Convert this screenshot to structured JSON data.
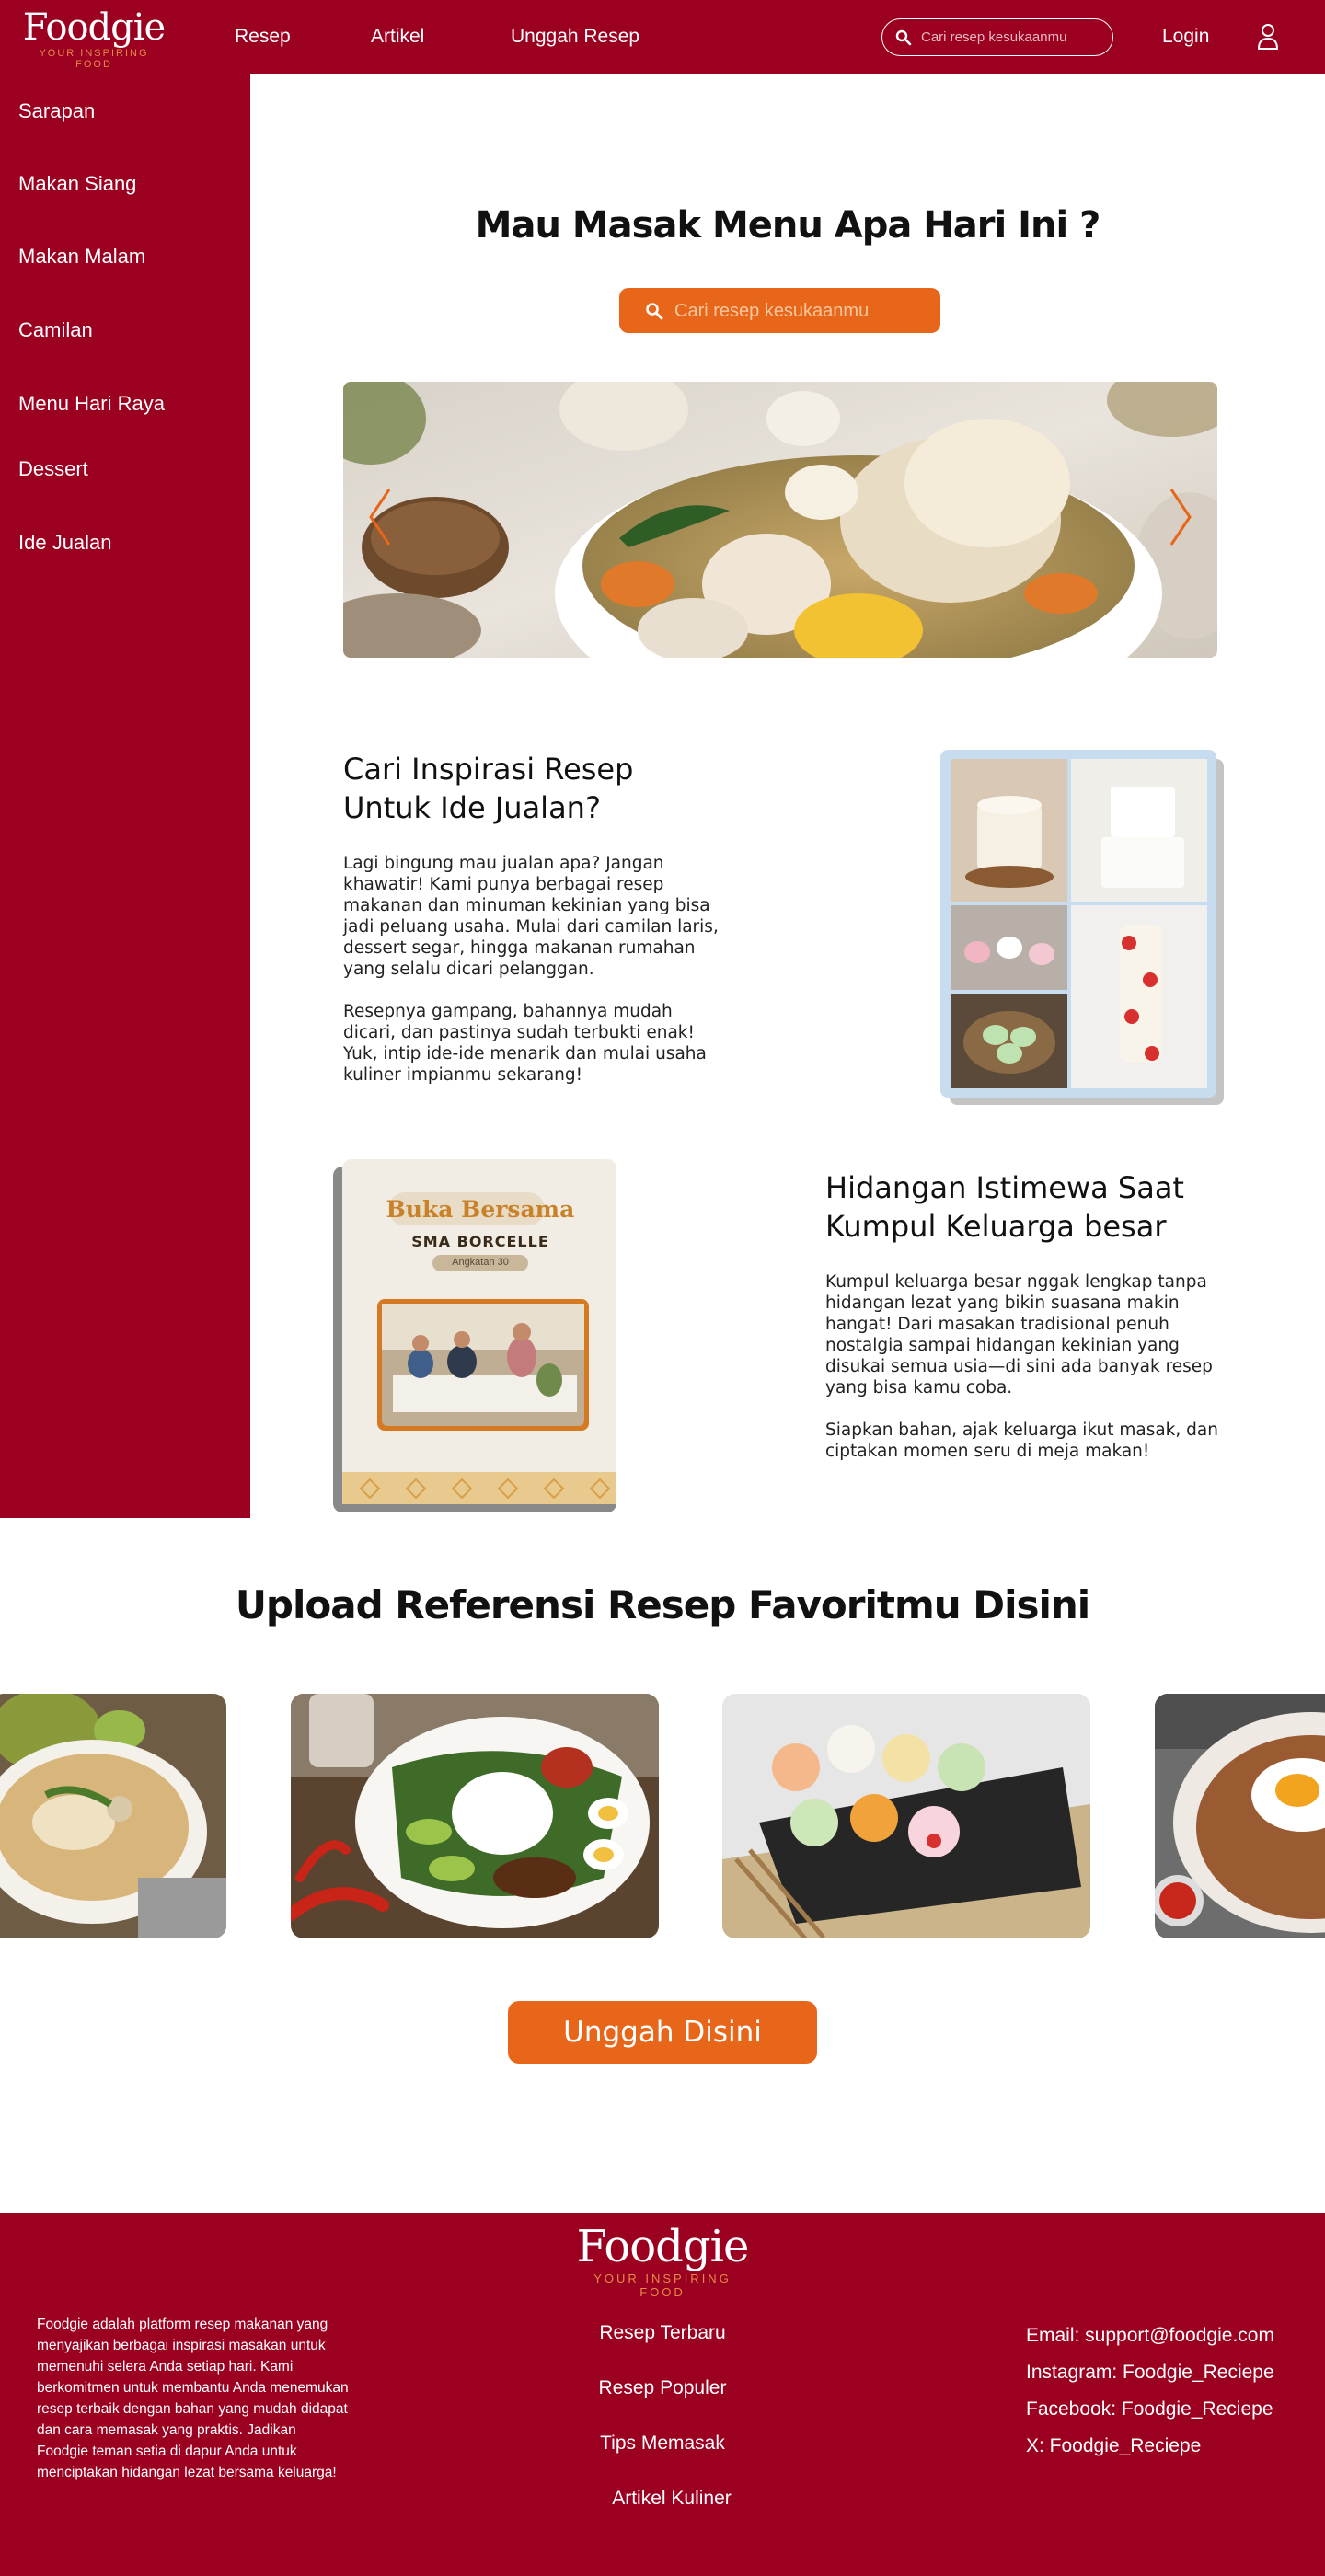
{
  "brand": {
    "name": "Foodgie",
    "tagline": "YOUR INSPIRING FOOD",
    "color_primary": "#9c0020",
    "color_accent": "#e8661a"
  },
  "header": {
    "nav": [
      "Resep",
      "Artikel",
      "Unggah Resep"
    ],
    "search_placeholder": "Cari resep kesukaanmu",
    "login_label": "Login",
    "icons": [
      "search-icon",
      "user-icon"
    ]
  },
  "sidebar": {
    "items": [
      "Sarapan",
      "Makan Siang",
      "Makan Malam",
      "Camilan",
      "Menu Hari Raya",
      "Dessert",
      "Ide Jualan"
    ]
  },
  "hero": {
    "title": "Mau Masak Menu Apa Hari Ini ?",
    "search_placeholder": "Cari resep kesukaanmu",
    "carousel_icons": [
      "chevron-left-icon",
      "chevron-right-icon"
    ]
  },
  "section_jualan": {
    "title": "Cari Inspirasi Resep Untuk Ide Jualan?",
    "paragraph1": "Lagi bingung mau jualan apa? Jangan khawatir! Kami punya berbagai resep makanan dan minuman kekinian yang bisa jadi peluang usaha. Mulai dari camilan laris, dessert segar, hingga makanan rumahan yang selalu dicari pelanggan.",
    "paragraph2": "Resepnya gampang, bahannya mudah dicari, dan pastinya sudah terbukti enak! Yuk, intip ide-ide menarik dan mulai usaha kuliner impianmu sekarang!"
  },
  "section_keluarga": {
    "poster_title": "Buka Bersama",
    "poster_subtitle": "SMA BORCELLE",
    "poster_badge": "Angkatan 30",
    "title": "Hidangan Istimewa Saat Kumpul Keluarga besar",
    "paragraph1": "Kumpul keluarga besar nggak lengkap tanpa hidangan lezat yang bikin suasana makin hangat! Dari masakan tradisional penuh nostalgia sampai hidangan kekinian yang disukai semua usia—di sini ada banyak resep yang bisa kamu coba.",
    "paragraph2": "Siapkan bahan, ajak keluarga ikut masak, dan ciptakan momen seru di meja makan!"
  },
  "upload": {
    "title": "Upload Referensi Resep Favoritmu Disini",
    "button_label": "Unggah Disini"
  },
  "footer": {
    "about": "Foodgie adalah platform resep makanan yang menyajikan berbagai inspirasi masakan untuk memenuhi selera Anda setiap hari. Kami berkomitmen untuk membantu Anda menemukan resep terbaik dengan bahan yang mudah didapat dan cara memasak yang praktis. Jadikan Foodgie teman setia di dapur Anda untuk menciptakan hidangan lezat bersama keluarga!",
    "links": [
      "Resep Terbaru",
      "Resep Populer",
      "Tips Memasak",
      "Artikel Kuliner"
    ],
    "contacts": [
      "Email: support@foodgie.com",
      "Instagram: Foodgie_Reciepe",
      "Facebook: Foodgie_Reciepe",
      "X: Foodgie_Reciepe"
    ]
  }
}
